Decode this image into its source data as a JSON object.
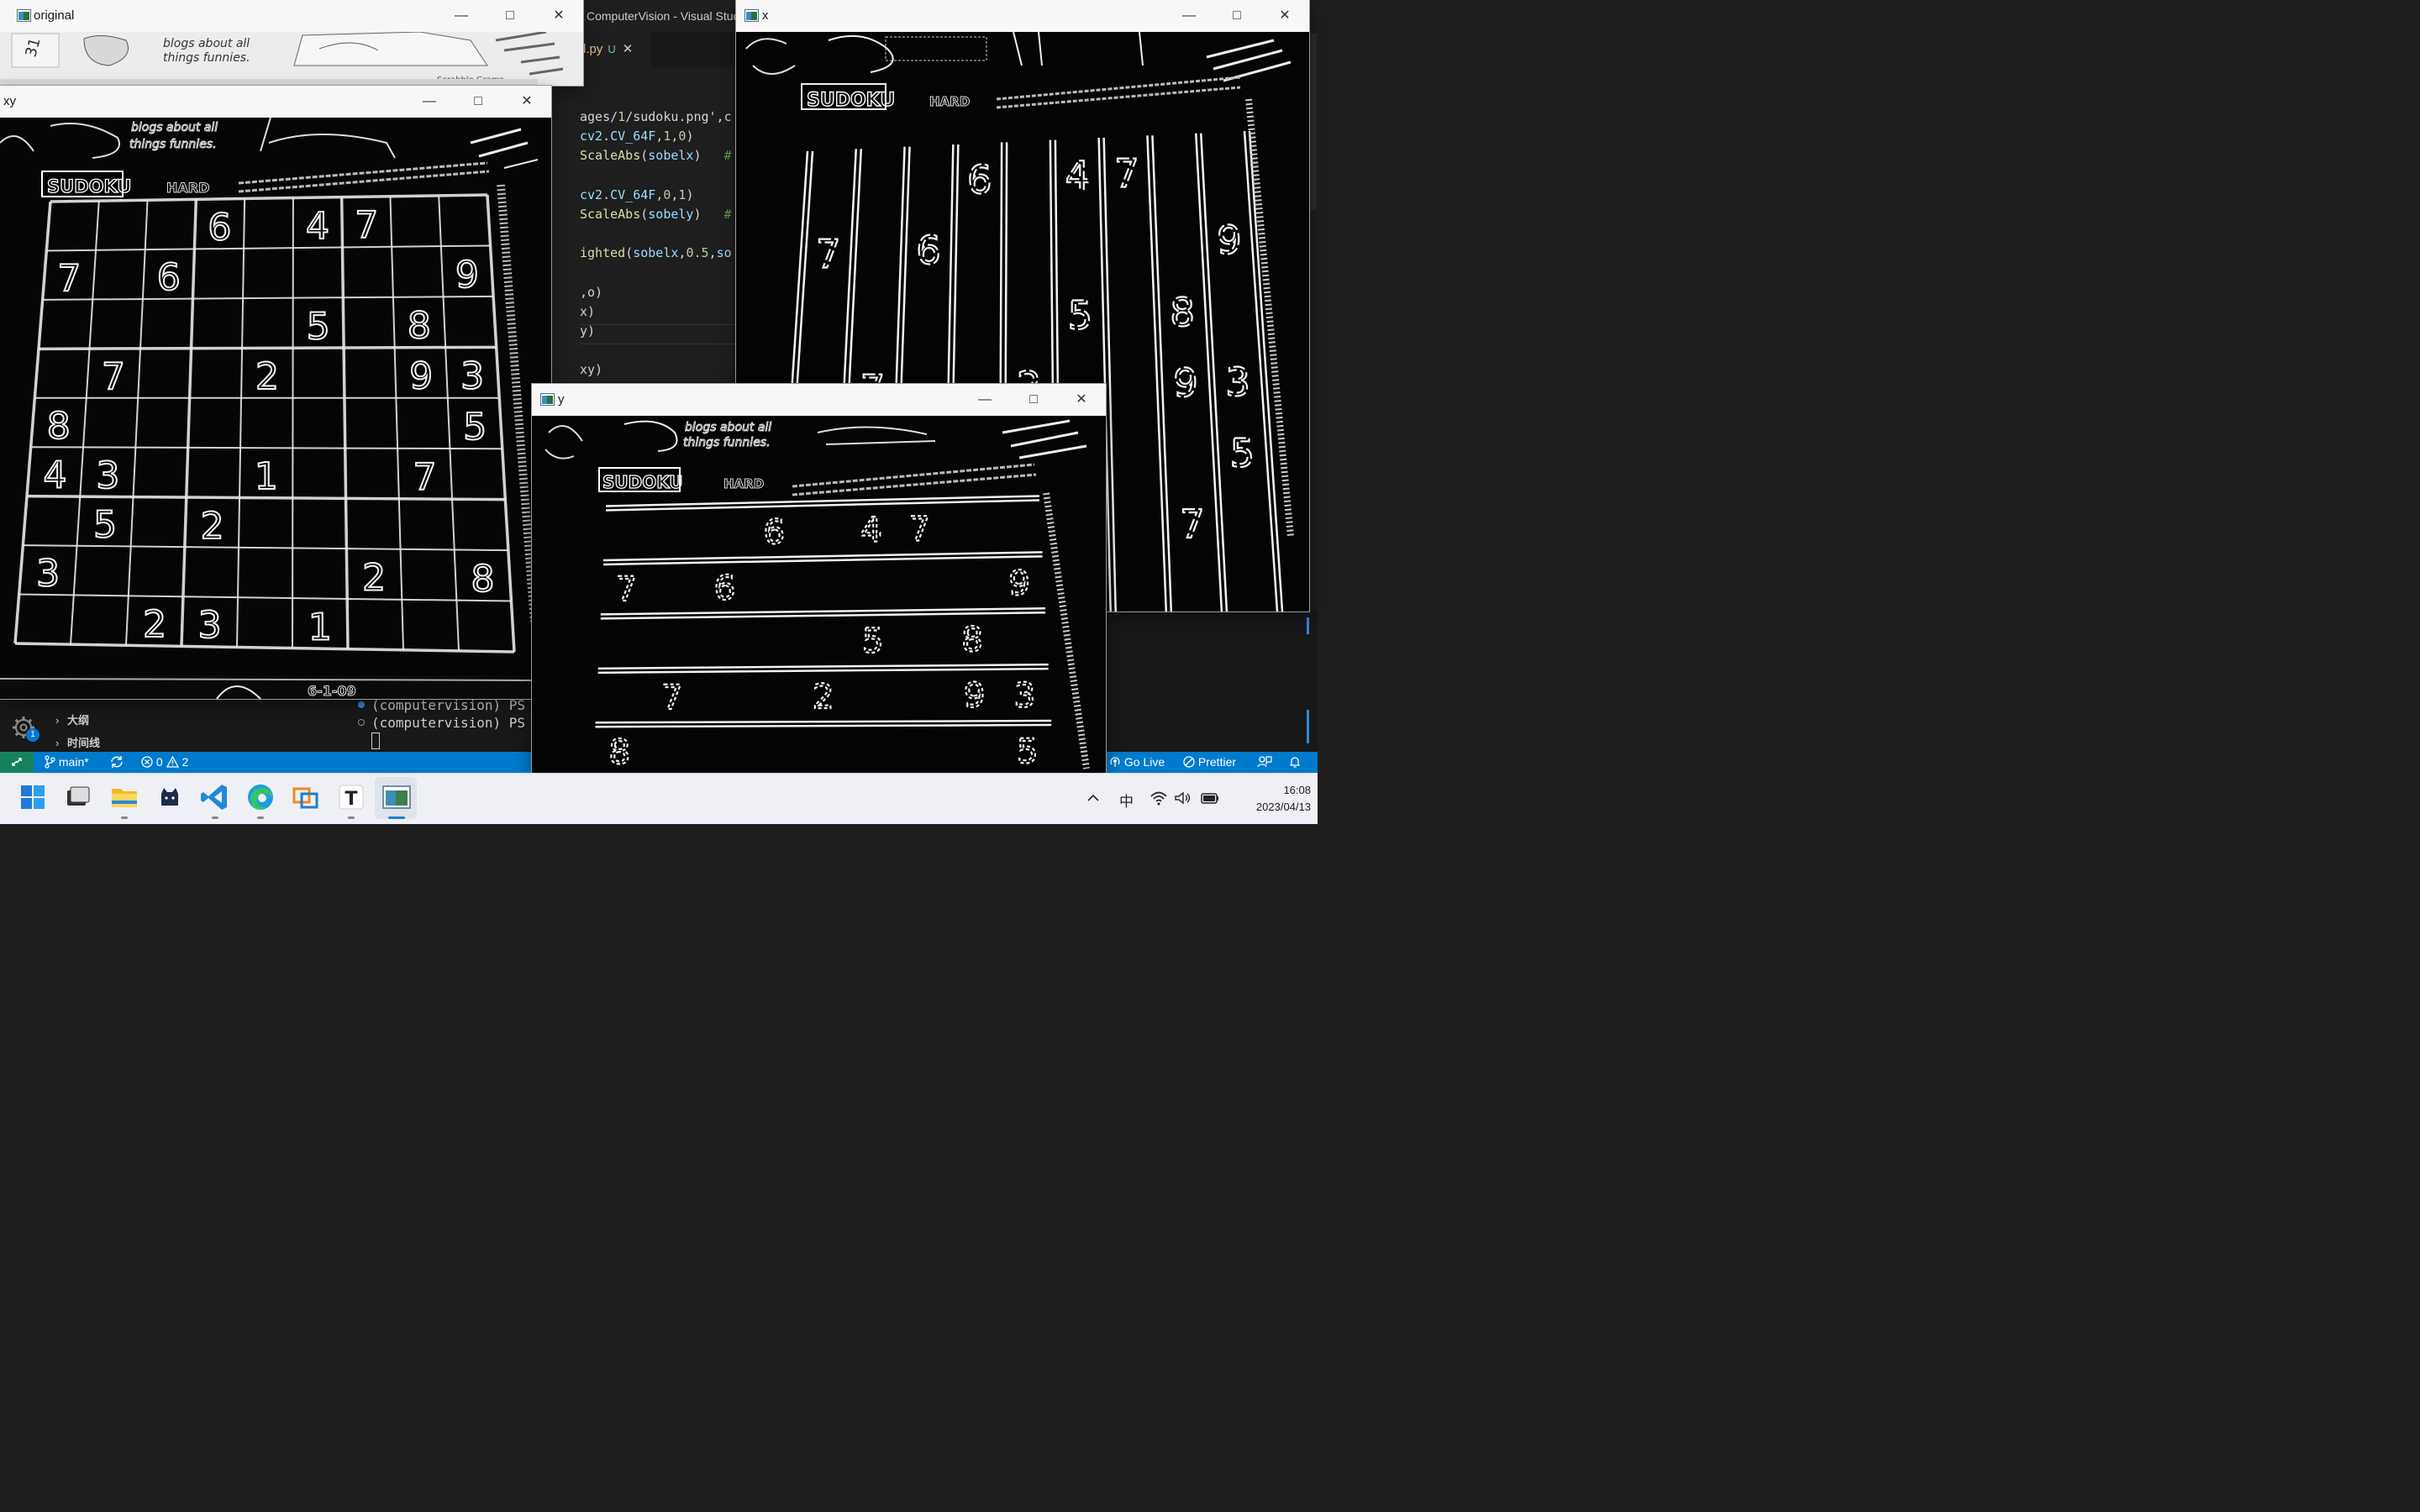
{
  "vscode": {
    "title": "ComputerVision - Visual Studio Code",
    "tab": {
      "filename": "l.py",
      "status": "U",
      "close": "✕"
    },
    "code_lines": [
      {
        "text": "ages/1/sudoku.png',c"
      },
      {
        "text": "cv2.CV_64F,1,0)"
      },
      {
        "text": "ScaleAbs(sobelx)   #"
      },
      {
        "text": ""
      },
      {
        "text": "cv2.CV_64F,0,1)"
      },
      {
        "text": "ScaleAbs(sobely)   #"
      },
      {
        "text": ""
      },
      {
        "text": "ighted(sobelx,0.5,so"
      },
      {
        "text": ""
      },
      {
        "text": ",o)"
      },
      {
        "text": "x)"
      },
      {
        "text": "y)"
      },
      {
        "text": ""
      },
      {
        "text": "xy)"
      }
    ],
    "sidebar": {
      "gear_badge": "1",
      "outline_items": [
        "大纲",
        "时间线"
      ]
    },
    "terminal": {
      "lines": [
        "(computervision) PS D",
        "(computervision) PS D"
      ]
    },
    "statusbar": {
      "branch": "main*",
      "errors": "0",
      "warnings": "2",
      "go_live": "Go Live",
      "prettier": "Prettier"
    }
  },
  "windows": {
    "original": {
      "title": "original",
      "snippet_line1": "blogs about all",
      "snippet_line2": "things funnies.",
      "snippet_line3": "Scrabble Grams",
      "page_number": "31"
    },
    "xy": {
      "title": "xy"
    },
    "x": {
      "title": "x"
    },
    "y": {
      "title": "y"
    }
  },
  "sudoku": {
    "header": "SUDOKU",
    "difficulty": "HARD",
    "grid_rows": [
      [
        "",
        "",
        "",
        "6",
        "",
        "4",
        "7",
        "",
        ""
      ],
      [
        "7",
        "",
        "6",
        "",
        "",
        "",
        "",
        "",
        "9"
      ],
      [
        "",
        "",
        "",
        "",
        "",
        "5",
        "",
        "8",
        ""
      ],
      [
        "",
        "7",
        "",
        "",
        "2",
        "",
        "",
        "9",
        "3"
      ],
      [
        "8",
        "",
        "",
        "",
        "",
        "",
        "",
        "",
        "5"
      ],
      [
        "4",
        "3",
        "",
        "",
        "1",
        "",
        "",
        "7",
        ""
      ],
      [
        "",
        "5",
        "",
        "2",
        "",
        "",
        "",
        "",
        ""
      ],
      [
        "3",
        "",
        "",
        "",
        "",
        "",
        "2",
        "",
        "8"
      ],
      [
        "",
        "",
        "2",
        "3",
        "",
        "1",
        "",
        "",
        ""
      ]
    ],
    "footer_code": "6-1-09"
  },
  "taskbar": {
    "ime": "中",
    "time": "16:08",
    "date": "2023/04/13"
  }
}
